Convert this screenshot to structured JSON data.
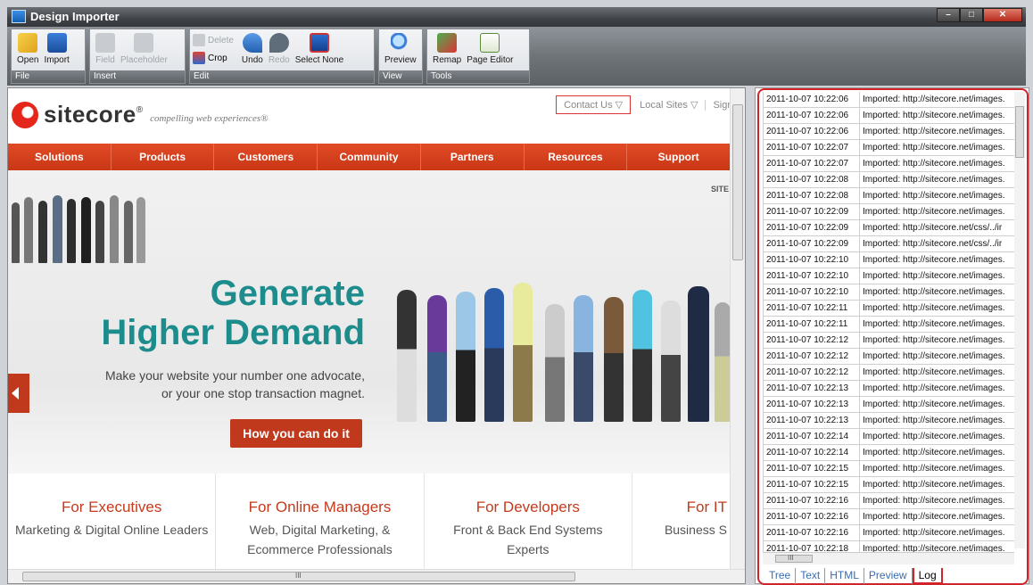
{
  "window": {
    "title": "Design Importer"
  },
  "ribbon": {
    "groups": [
      {
        "label": "File",
        "buttons": [
          {
            "label": "Open",
            "enabled": true
          },
          {
            "label": "Import",
            "enabled": true
          }
        ]
      },
      {
        "label": "Insert",
        "buttons": [
          {
            "label": "Field",
            "enabled": false
          },
          {
            "label": "Placeholder",
            "enabled": false
          }
        ]
      },
      {
        "label": "Edit",
        "small": [
          {
            "label": "Delete",
            "enabled": false
          },
          {
            "label": "Crop",
            "enabled": true
          }
        ],
        "buttons": [
          {
            "label": "Undo",
            "enabled": true
          },
          {
            "label": "Redo",
            "enabled": false
          },
          {
            "label": "Select None",
            "enabled": true
          }
        ]
      },
      {
        "label": "View",
        "buttons": [
          {
            "label": "Preview",
            "enabled": true
          }
        ]
      },
      {
        "label": "Tools",
        "buttons": [
          {
            "label": "Remap",
            "enabled": true
          },
          {
            "label": "Page Editor",
            "enabled": true
          }
        ]
      }
    ]
  },
  "site": {
    "topnav": {
      "contact": "Contact Us ▽",
      "local": "Local Sites ▽",
      "sign": "Sigr"
    },
    "logo": {
      "word": "sitecore",
      "mark_suffix": "®",
      "tagline": "compelling web experiences®"
    },
    "nav": [
      "Solutions",
      "Products",
      "Customers",
      "Community",
      "Partners",
      "Resources",
      "Support"
    ],
    "hero": {
      "site_label": "SITE",
      "headline1": "Generate",
      "headline2": "Higher Demand",
      "sub1": "Make your website your number one advocate,",
      "sub2": "or your one stop transaction magnet.",
      "cta": "How you can do it"
    },
    "columns": [
      {
        "title": "For Executives",
        "desc1": "Marketing & Digital Online Leaders",
        "desc2": ""
      },
      {
        "title": "For Online Managers",
        "desc1": "Web, Digital Marketing, &",
        "desc2": "Ecommerce Professionals"
      },
      {
        "title": "For Developers",
        "desc1": "Front & Back End Systems",
        "desc2": "Experts"
      },
      {
        "title": "For IT",
        "desc1": "Business S",
        "desc2": ""
      }
    ],
    "colors": {
      "accent": "#c0391d",
      "teal": "#1d8c8c"
    }
  },
  "log": {
    "rows": [
      {
        "t": "2011-10-07 10:22:06",
        "m": "Imported: http://sitecore.net/images."
      },
      {
        "t": "2011-10-07 10:22:06",
        "m": "Imported: http://sitecore.net/images."
      },
      {
        "t": "2011-10-07 10:22:06",
        "m": "Imported: http://sitecore.net/images."
      },
      {
        "t": "2011-10-07 10:22:07",
        "m": "Imported: http://sitecore.net/images."
      },
      {
        "t": "2011-10-07 10:22:07",
        "m": "Imported: http://sitecore.net/images."
      },
      {
        "t": "2011-10-07 10:22:08",
        "m": "Imported: http://sitecore.net/images."
      },
      {
        "t": "2011-10-07 10:22:08",
        "m": "Imported: http://sitecore.net/images."
      },
      {
        "t": "2011-10-07 10:22:09",
        "m": "Imported: http://sitecore.net/images."
      },
      {
        "t": "2011-10-07 10:22:09",
        "m": "Imported: http://sitecore.net/css/../ir"
      },
      {
        "t": "2011-10-07 10:22:09",
        "m": "Imported: http://sitecore.net/css/../ir"
      },
      {
        "t": "2011-10-07 10:22:10",
        "m": "Imported: http://sitecore.net/images."
      },
      {
        "t": "2011-10-07 10:22:10",
        "m": "Imported: http://sitecore.net/images."
      },
      {
        "t": "2011-10-07 10:22:10",
        "m": "Imported: http://sitecore.net/images."
      },
      {
        "t": "2011-10-07 10:22:11",
        "m": "Imported: http://sitecore.net/images."
      },
      {
        "t": "2011-10-07 10:22:11",
        "m": "Imported: http://sitecore.net/images."
      },
      {
        "t": "2011-10-07 10:22:12",
        "m": "Imported: http://sitecore.net/images."
      },
      {
        "t": "2011-10-07 10:22:12",
        "m": "Imported: http://sitecore.net/images."
      },
      {
        "t": "2011-10-07 10:22:12",
        "m": "Imported: http://sitecore.net/images."
      },
      {
        "t": "2011-10-07 10:22:13",
        "m": "Imported: http://sitecore.net/images."
      },
      {
        "t": "2011-10-07 10:22:13",
        "m": "Imported: http://sitecore.net/images."
      },
      {
        "t": "2011-10-07 10:22:13",
        "m": "Imported: http://sitecore.net/images."
      },
      {
        "t": "2011-10-07 10:22:14",
        "m": "Imported: http://sitecore.net/images."
      },
      {
        "t": "2011-10-07 10:22:14",
        "m": "Imported: http://sitecore.net/images."
      },
      {
        "t": "2011-10-07 10:22:15",
        "m": "Imported: http://sitecore.net/images."
      },
      {
        "t": "2011-10-07 10:22:15",
        "m": "Imported: http://sitecore.net/images."
      },
      {
        "t": "2011-10-07 10:22:16",
        "m": "Imported: http://sitecore.net/images."
      },
      {
        "t": "2011-10-07 10:22:16",
        "m": "Imported: http://sitecore.net/images."
      },
      {
        "t": "2011-10-07 10:22:16",
        "m": "Imported: http://sitecore.net/images."
      },
      {
        "t": "2011-10-07 10:22:18",
        "m": "Imported: http://sitecore.net/images."
      }
    ],
    "tabs": [
      "Tree",
      "Text",
      "HTML",
      "Preview",
      "Log"
    ],
    "active_tab": "Log",
    "hscroll_glyph": "III"
  }
}
